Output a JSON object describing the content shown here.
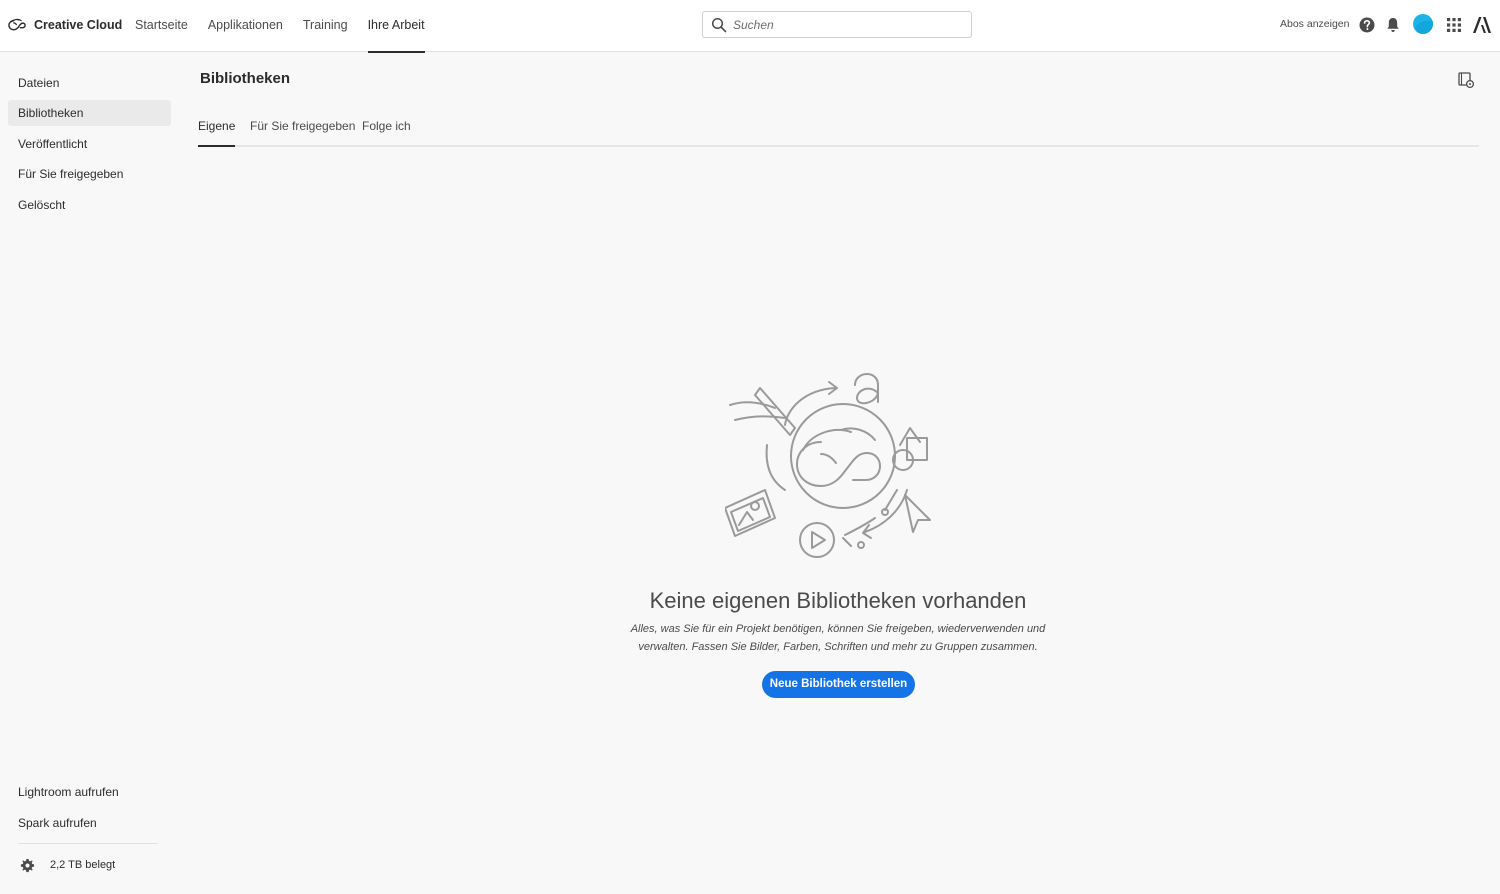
{
  "app": {
    "name": "Creative Cloud"
  },
  "topnav": {
    "items": [
      {
        "label": "Startseite"
      },
      {
        "label": "Applikationen"
      },
      {
        "label": "Training"
      },
      {
        "label": "Ihre Arbeit",
        "active": true
      }
    ]
  },
  "search": {
    "placeholder": "Suchen",
    "value": ""
  },
  "header_right": {
    "plans_label": "Abos anzeigen",
    "icons": [
      "help-icon",
      "bell-icon",
      "avatar",
      "apps-grid-icon",
      "adobe-logo-icon"
    ],
    "avatar_color": "#1ab4e6"
  },
  "sidebar": {
    "items": [
      {
        "label": "Dateien"
      },
      {
        "label": "Bibliotheken",
        "active": true
      },
      {
        "label": "Veröffentlicht"
      },
      {
        "label": "Für Sie freigegeben"
      },
      {
        "label": "Gelöscht"
      }
    ],
    "bottom_links": [
      {
        "label": "Lightroom aufrufen"
      },
      {
        "label": "Spark aufrufen"
      }
    ],
    "storage": "2,2 TB belegt"
  },
  "main": {
    "title": "Bibliotheken",
    "tabs": [
      {
        "label": "Eigene",
        "active": true
      },
      {
        "label": "Für Sie freigegeben"
      },
      {
        "label": "Folge ich"
      }
    ],
    "empty_state": {
      "title": "Keine eigenen Bibliotheken vorhanden",
      "description_line1": "Alles, was Sie für ein Projekt benötigen, können Sie freigeben, wiederverwenden und",
      "description_line2": "verwalten. Fassen Sie Bilder, Farben, Schriften und mehr zu Gruppen zusammen.",
      "button_label": "Neue Bibliothek erstellen"
    }
  },
  "colors": {
    "accent": "#1473e6",
    "background": "#f8f8f8",
    "topbar": "#ffffff",
    "text": "#2c2c2c"
  }
}
